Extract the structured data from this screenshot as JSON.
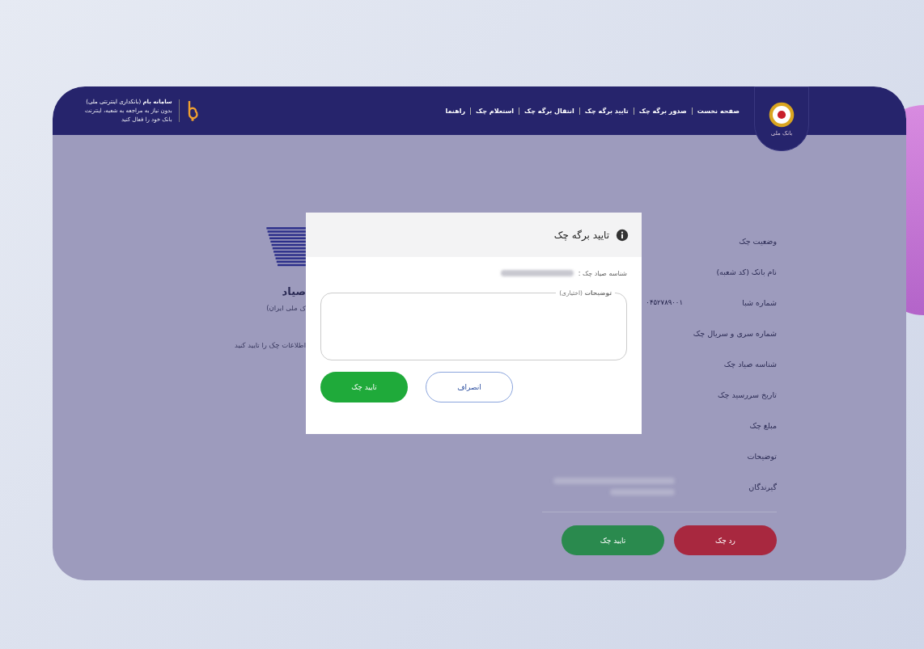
{
  "header": {
    "emblem_caption": "بانک ملی",
    "nav": [
      "صفحه نخست",
      "صدور برگه چک",
      "تایید برگه چک",
      "انتقال برگه چک",
      "استعلام چک",
      "راهنما"
    ],
    "app_title": "**سامانه بام** (بانکداری اینترنتی ملی)",
    "app_subtitle": [
      "بدون نیاز به مراجعه به شعبه، اینترنت",
      "بانک خود را فعال کنید"
    ]
  },
  "intro": {
    "title": "صیاد",
    "subtitle": "ک ملی ایران)",
    "instruction": "اطلاعات چک را تایید کنید"
  },
  "details": {
    "fields": [
      {
        "label": "وضعیت چک"
      },
      {
        "label": "نام بانک (کد شعبه)"
      },
      {
        "label": "شماره شبا",
        "value": "۰۴۵۲۷۸۹۰۰۱"
      },
      {
        "label": "شماره سری و سریال چک"
      },
      {
        "label": "شناسه صیاد چک"
      },
      {
        "label": "تاریخ سررسید چک"
      },
      {
        "label": "مبلغ چک"
      },
      {
        "label": "توضیحات"
      },
      {
        "label": "گیرندگان",
        "redacted": true
      }
    ],
    "buttons": [
      {
        "label": "رد چک",
        "kind": "reject"
      },
      {
        "label": "تایید چک",
        "kind": "confirm"
      }
    ]
  },
  "dialog": {
    "title": "تایید برگه چک",
    "sayad_label": "شناسه صیاد چک :",
    "sayad_redacted": true,
    "notes": {
      "legend": "**توضیحات** (اختیاری)"
    },
    "buttons": [
      {
        "label": "انصراف",
        "kind": "cancel"
      },
      {
        "label": "تایید چک",
        "kind": "confirm"
      }
    ]
  }
}
